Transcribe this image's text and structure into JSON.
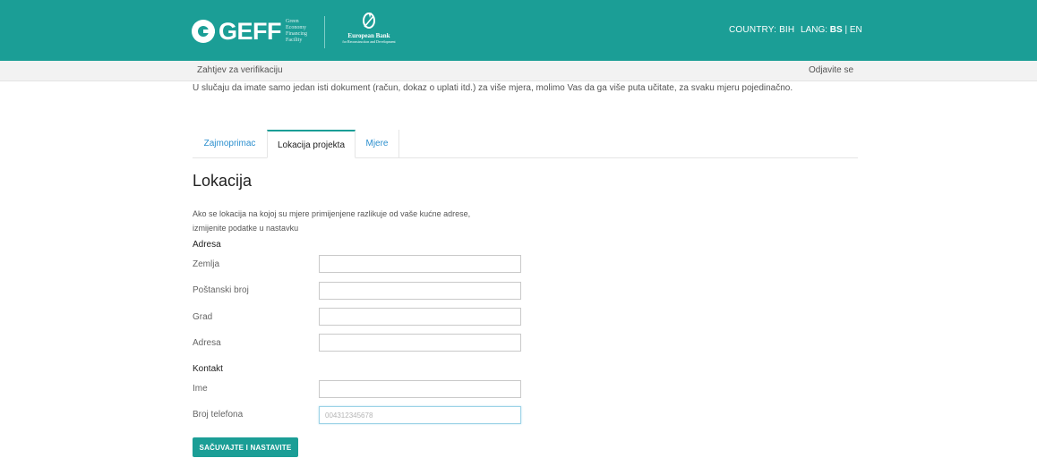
{
  "header": {
    "brand": {
      "name": "GEFF",
      "tagline": [
        "Green",
        "Economy",
        "Financing",
        "Facility"
      ],
      "partner_name": "European Bank",
      "partner_sub": "for Reconstruction and Development"
    },
    "country": "COUNTRY: BIH",
    "lang_prefix": "LANG:",
    "lang_active": "BS",
    "lang_sep": "|",
    "lang_other": "EN"
  },
  "subnav": {
    "left_link": "Zahtjev za verifikaciju",
    "right_link": "Odjavite se"
  },
  "notice": "U slučaju da imate samo jedan isti dokument (račun, dokaz o uplati itd.) za više mjera, molimo Vas da ga više puta učitate, za svaku mjeru pojedinačno.",
  "tabs": [
    {
      "label": "Zajmoprimac"
    },
    {
      "label": "Lokacija projekta",
      "active": true
    },
    {
      "label": "Mjere"
    }
  ],
  "section": {
    "title": "Lokacija",
    "description_line1": "Ako se lokacija na kojoj su mjere primijenjene razlikuje od vaše kućne adrese,",
    "description_line2": "izmijenite podatke u nastavku"
  },
  "address_group": {
    "label": "Adresa",
    "fields": [
      {
        "label": "Zemlja",
        "value": ""
      },
      {
        "label": "Poštanski broj",
        "value": ""
      },
      {
        "label": "Grad",
        "value": ""
      },
      {
        "label": "Adresa",
        "value": ""
      }
    ]
  },
  "contact_group": {
    "label": "Kontakt",
    "fields": [
      {
        "label": "Ime",
        "value": ""
      },
      {
        "label": "Broj telefona",
        "value": "",
        "placeholder": "004312345678"
      }
    ]
  },
  "submit_label": "SAČUVAJTE I NASTAVITE",
  "colors": {
    "brand_teal": "#1b9e96",
    "link_blue": "#2c8fce"
  }
}
